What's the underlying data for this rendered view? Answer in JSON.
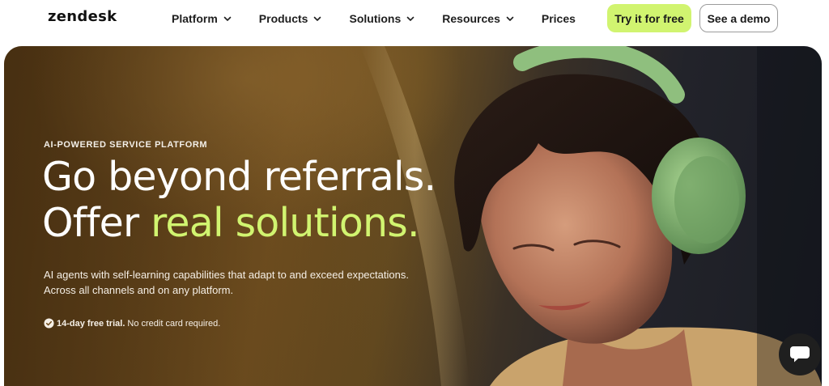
{
  "brand": {
    "logo_text": "zendesk"
  },
  "nav": {
    "items": [
      {
        "label": "Platform",
        "has_dropdown": true,
        "icon": "chevron-down-icon"
      },
      {
        "label": "Products",
        "has_dropdown": true,
        "icon": "chevron-down-icon"
      },
      {
        "label": "Solutions",
        "has_dropdown": true,
        "icon": "chevron-down-icon"
      },
      {
        "label": "Resources",
        "has_dropdown": true,
        "icon": "chevron-down-icon"
      },
      {
        "label": "Prices",
        "has_dropdown": false
      }
    ],
    "try_label": "Try it for free",
    "demo_label": "See a demo"
  },
  "hero": {
    "eyebrow": "AI-POWERED SERVICE PLATFORM",
    "headline_line1": "Go beyond referrals.",
    "headline_line2_prefix": "Offer ",
    "headline_line2_accent": "real solutions.",
    "subtext_line1": "AI agents with self-learning capabilities that adapt to and exceed expectations.",
    "subtext_line2": "Across all channels and on any platform.",
    "trial_bold": "14-day free trial.",
    "trial_rest": "No credit card required.",
    "trial_icon": "check-circle-icon"
  },
  "chat": {
    "icon": "chat-bubble-icon"
  },
  "colors": {
    "accent": "#d1f470",
    "hero_text": "#ffffff",
    "headphones": "#8fbf7e",
    "chat_button": "#1f1f1f"
  }
}
